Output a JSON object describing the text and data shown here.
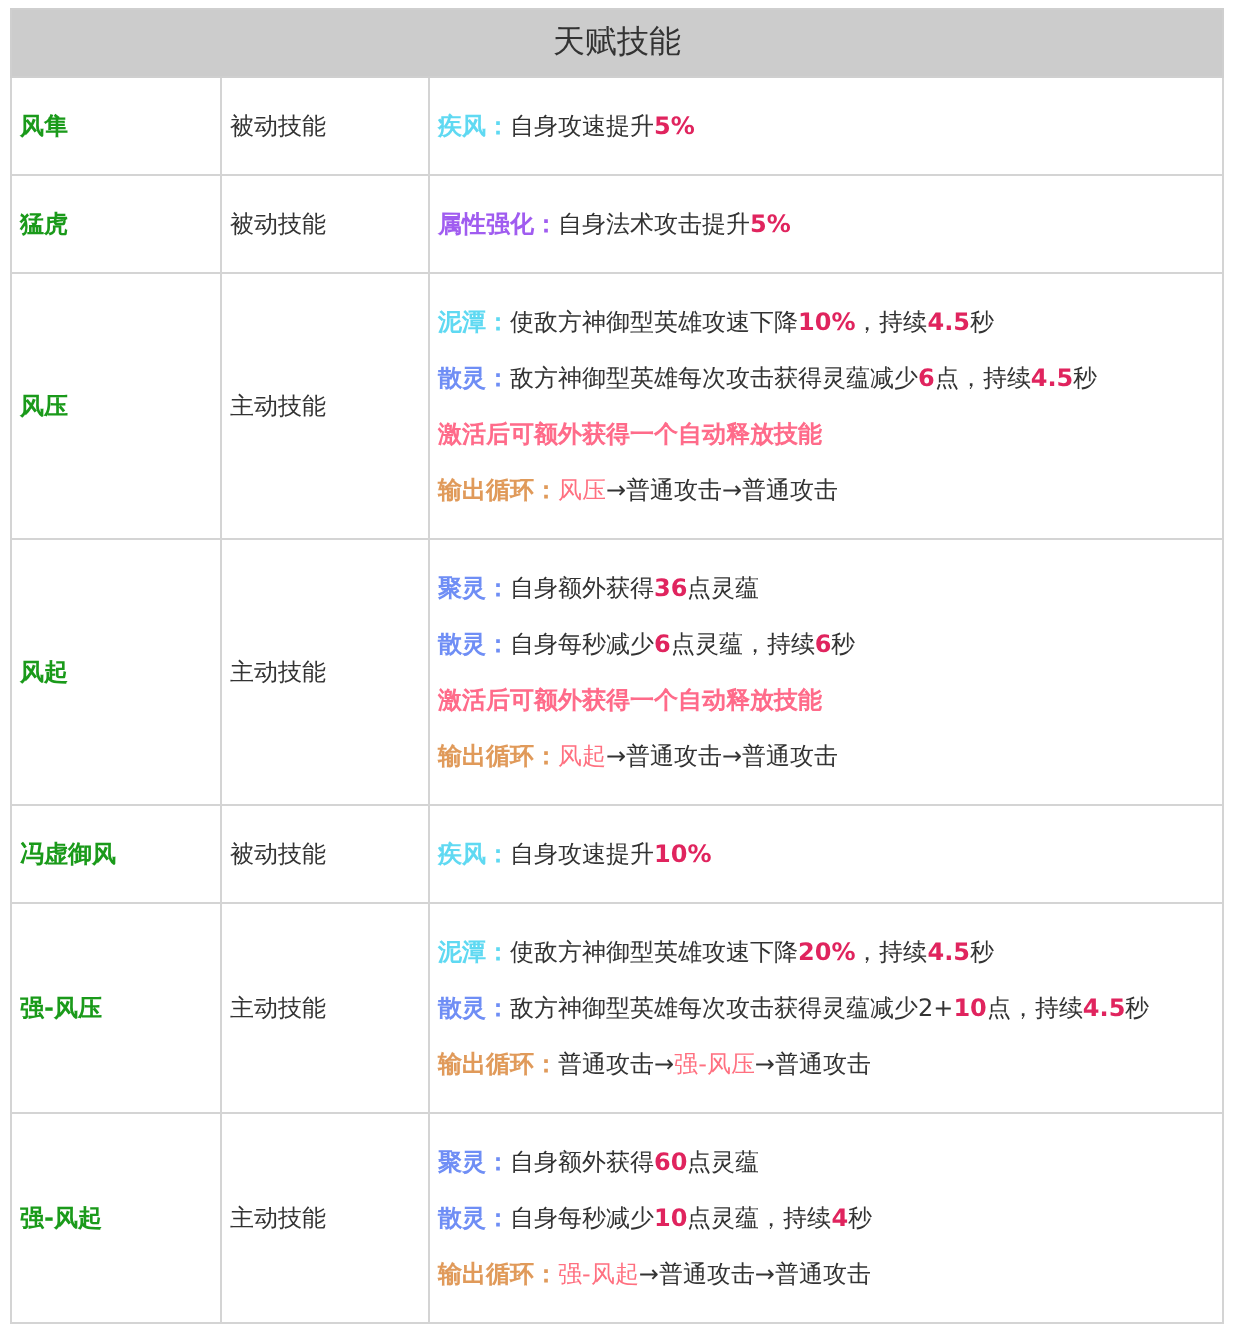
{
  "table": {
    "title": "天赋技能",
    "rows": [
      {
        "name": "风隼",
        "type": "被动技能",
        "lines": [
          [
            {
              "kind": "label",
              "text": "疾风：",
              "color": "#5fd9f2"
            },
            {
              "kind": "plain",
              "text": "自身攻速提升"
            },
            {
              "kind": "number",
              "text": "5%"
            }
          ]
        ]
      },
      {
        "name": "猛虎",
        "type": "被动技能",
        "lines": [
          [
            {
              "kind": "label",
              "text": "属性强化：",
              "color": "#a05cf0"
            },
            {
              "kind": "plain",
              "text": "自身法术攻击提升"
            },
            {
              "kind": "number",
              "text": "5%"
            }
          ]
        ]
      },
      {
        "name": "风压",
        "type": "主动技能",
        "lines": [
          [
            {
              "kind": "label",
              "text": "泥潭：",
              "color": "#5fd9f2"
            },
            {
              "kind": "plain",
              "text": "使敌方神御型英雄攻速下降"
            },
            {
              "kind": "number",
              "text": "10%"
            },
            {
              "kind": "plain",
              "text": "，持续"
            },
            {
              "kind": "number",
              "text": "4.5"
            },
            {
              "kind": "plain",
              "text": "秒"
            }
          ],
          [
            {
              "kind": "label",
              "text": "散灵：",
              "color": "#6f8ef5"
            },
            {
              "kind": "plain",
              "text": "敌方神御型英雄每次攻击获得灵蕴减少"
            },
            {
              "kind": "number",
              "text": "6"
            },
            {
              "kind": "plain",
              "text": "点，持续"
            },
            {
              "kind": "number",
              "text": "4.5"
            },
            {
              "kind": "plain",
              "text": "秒"
            }
          ],
          [
            {
              "kind": "note",
              "text": "激活后可额外获得一个自动释放技能"
            }
          ],
          [
            {
              "kind": "label",
              "text": "输出循环：",
              "color": "#e09a5a"
            },
            {
              "kind": "skill",
              "text": "风压"
            },
            {
              "kind": "plain",
              "text": "→普通攻击→普通攻击"
            }
          ]
        ]
      },
      {
        "name": "风起",
        "type": "主动技能",
        "lines": [
          [
            {
              "kind": "label",
              "text": "聚灵：",
              "color": "#6f8ef5"
            },
            {
              "kind": "plain",
              "text": "自身额外获得"
            },
            {
              "kind": "number",
              "text": "36"
            },
            {
              "kind": "plain",
              "text": "点灵蕴"
            }
          ],
          [
            {
              "kind": "label",
              "text": "散灵：",
              "color": "#6f8ef5"
            },
            {
              "kind": "plain",
              "text": "自身每秒减少"
            },
            {
              "kind": "number",
              "text": "6"
            },
            {
              "kind": "plain",
              "text": "点灵蕴，持续"
            },
            {
              "kind": "number",
              "text": "6"
            },
            {
              "kind": "plain",
              "text": "秒"
            }
          ],
          [
            {
              "kind": "note",
              "text": "激活后可额外获得一个自动释放技能"
            }
          ],
          [
            {
              "kind": "label",
              "text": "输出循环：",
              "color": "#e09a5a"
            },
            {
              "kind": "skill",
              "text": "风起"
            },
            {
              "kind": "plain",
              "text": "→普通攻击→普通攻击"
            }
          ]
        ]
      },
      {
        "name": "冯虚御风",
        "type": "被动技能",
        "lines": [
          [
            {
              "kind": "label",
              "text": "疾风：",
              "color": "#5fd9f2"
            },
            {
              "kind": "plain",
              "text": "自身攻速提升"
            },
            {
              "kind": "number",
              "text": "10%"
            }
          ]
        ]
      },
      {
        "name": "强-风压",
        "type": "主动技能",
        "lines": [
          [
            {
              "kind": "label",
              "text": "泥潭：",
              "color": "#5fd9f2"
            },
            {
              "kind": "plain",
              "text": "使敌方神御型英雄攻速下降"
            },
            {
              "kind": "number",
              "text": "20%"
            },
            {
              "kind": "plain",
              "text": "，持续"
            },
            {
              "kind": "number",
              "text": "4.5"
            },
            {
              "kind": "plain",
              "text": "秒"
            }
          ],
          [
            {
              "kind": "label",
              "text": "散灵：",
              "color": "#6f8ef5"
            },
            {
              "kind": "plain",
              "text": "敌方神御型英雄每次攻击获得灵蕴减少2+"
            },
            {
              "kind": "number",
              "text": "10"
            },
            {
              "kind": "plain",
              "text": "点，持续"
            },
            {
              "kind": "number",
              "text": "4.5"
            },
            {
              "kind": "plain",
              "text": "秒"
            }
          ],
          [
            {
              "kind": "label",
              "text": "输出循环：",
              "color": "#e09a5a"
            },
            {
              "kind": "plain",
              "text": "普通攻击→"
            },
            {
              "kind": "skill",
              "text": "强-风压"
            },
            {
              "kind": "plain",
              "text": "→普通攻击"
            }
          ]
        ]
      },
      {
        "name": "强-风起",
        "type": "主动技能",
        "lines": [
          [
            {
              "kind": "label",
              "text": "聚灵：",
              "color": "#6f8ef5"
            },
            {
              "kind": "plain",
              "text": "自身额外获得"
            },
            {
              "kind": "number",
              "text": "60"
            },
            {
              "kind": "plain",
              "text": "点灵蕴"
            }
          ],
          [
            {
              "kind": "label",
              "text": "散灵：",
              "color": "#6f8ef5"
            },
            {
              "kind": "plain",
              "text": "自身每秒减少"
            },
            {
              "kind": "number",
              "text": "10"
            },
            {
              "kind": "plain",
              "text": "点灵蕴，持续"
            },
            {
              "kind": "number",
              "text": "4"
            },
            {
              "kind": "plain",
              "text": "秒"
            }
          ],
          [
            {
              "kind": "label",
              "text": "输出循环：",
              "color": "#e09a5a"
            },
            {
              "kind": "skill",
              "text": "强-风起"
            },
            {
              "kind": "plain",
              "text": "→普通攻击→普通攻击"
            }
          ]
        ]
      }
    ]
  }
}
